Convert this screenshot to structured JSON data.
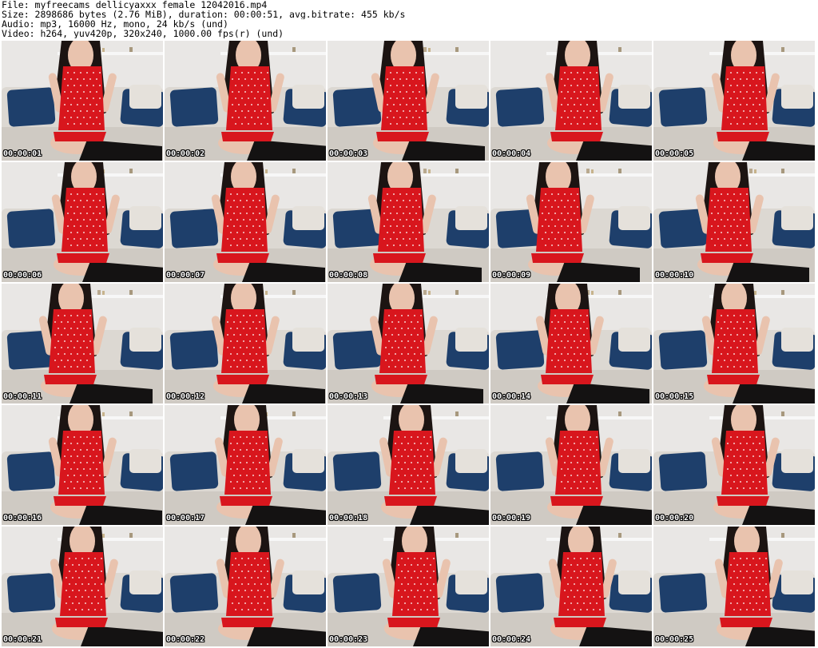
{
  "header": {
    "file_line": "File: myfreecams_dellicyaxxx_female_12042016.mp4",
    "size_line": "Size: 2898686 bytes (2.76 MiB), duration: 00:00:51, avg.bitrate: 455 kb/s",
    "audio_line": "Audio: mp3, 16000 Hz, mono, 24 kb/s (und)",
    "video_line": "Video: h264, yuv420p, 320x240, 1000.00 fps(r) (und)"
  },
  "thumbnails": [
    {
      "timestamp": "00:00:01"
    },
    {
      "timestamp": "00:00:02"
    },
    {
      "timestamp": "00:00:03"
    },
    {
      "timestamp": "00:00:04"
    },
    {
      "timestamp": "00:00:05"
    },
    {
      "timestamp": "00:00:06"
    },
    {
      "timestamp": "00:00:07"
    },
    {
      "timestamp": "00:00:08"
    },
    {
      "timestamp": "00:00:09"
    },
    {
      "timestamp": "00:00:10"
    },
    {
      "timestamp": "00:00:11"
    },
    {
      "timestamp": "00:00:12"
    },
    {
      "timestamp": "00:00:13"
    },
    {
      "timestamp": "00:00:14"
    },
    {
      "timestamp": "00:00:15"
    },
    {
      "timestamp": "00:00:16"
    },
    {
      "timestamp": "00:00:17"
    },
    {
      "timestamp": "00:00:18"
    },
    {
      "timestamp": "00:00:19"
    },
    {
      "timestamp": "00:00:20"
    },
    {
      "timestamp": "00:00:21"
    },
    {
      "timestamp": "00:00:22"
    },
    {
      "timestamp": "00:00:23"
    },
    {
      "timestamp": "00:00:24"
    },
    {
      "timestamp": "00:00:25"
    }
  ],
  "colors": {
    "wall": "#e9e7e5",
    "sofa": "#dcd8d2",
    "pillow": "#1e3f6b",
    "dress": "#d8161d",
    "hair": "#1c1412",
    "skin": "#e9c3ae",
    "stocking": "#141212"
  }
}
